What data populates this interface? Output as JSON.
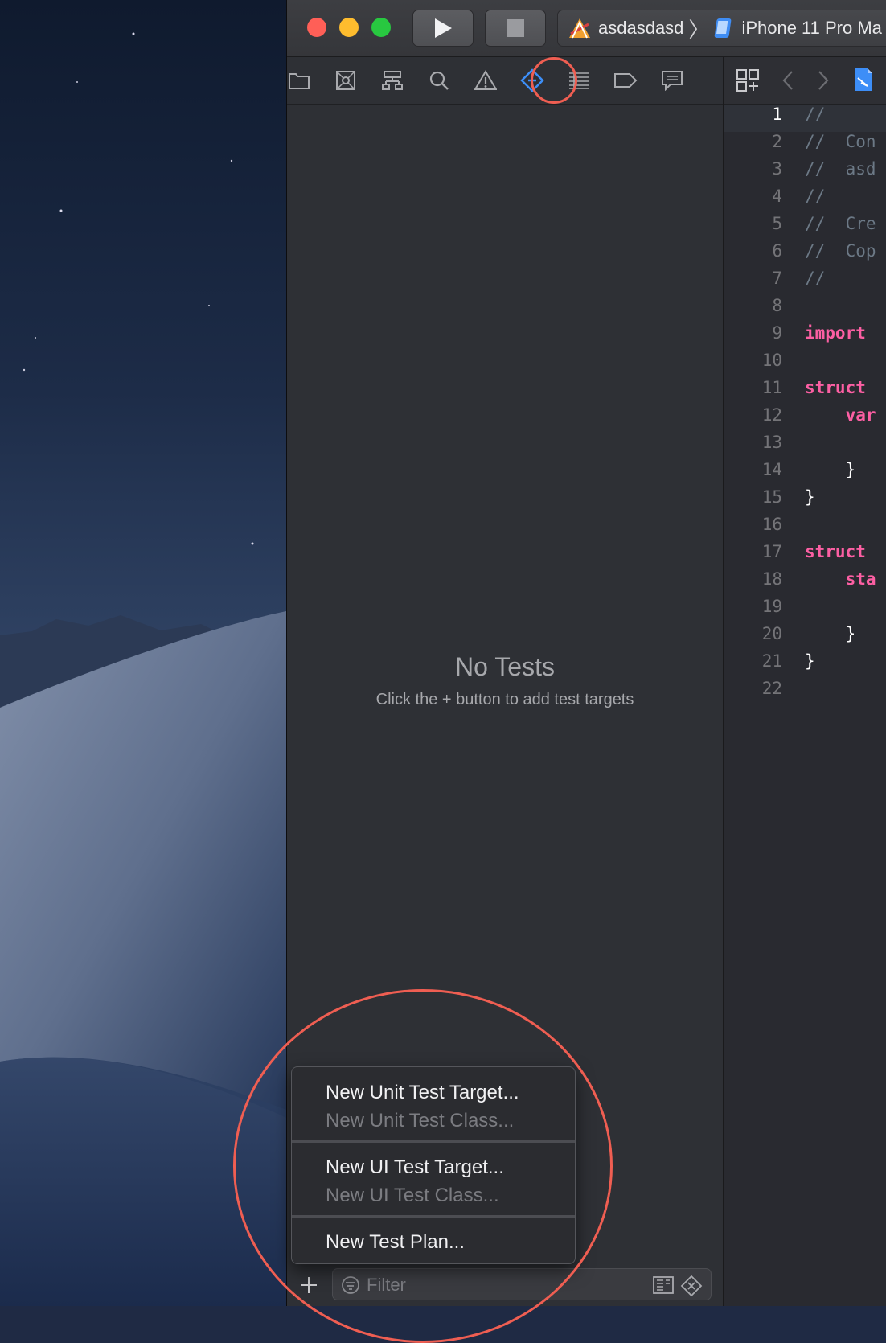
{
  "window": {
    "scheme_project": "asdasdasd",
    "scheme_device": "iPhone 11 Pro Ma"
  },
  "navigator_icons": [
    "folder-icon",
    "source-control-icon",
    "hierarchy-icon",
    "search-icon",
    "warning-icon",
    "test-diamond-icon",
    "debug-icon",
    "breakpoint-icon",
    "report-icon"
  ],
  "test_navigator": {
    "empty_title": "No Tests",
    "empty_subtitle": "Click the + button to add test targets"
  },
  "filter": {
    "placeholder": "Filter"
  },
  "add_menu": {
    "items": [
      {
        "label": "New Unit Test Target...",
        "enabled": true
      },
      {
        "label": "New Unit Test Class...",
        "enabled": false
      },
      {
        "label": "New UI Test Target...",
        "enabled": true
      },
      {
        "label": "New UI Test Class...",
        "enabled": false
      },
      {
        "label": "New Test Plan...",
        "enabled": true
      }
    ]
  },
  "editor": {
    "lines": [
      {
        "n": "1",
        "text": "//"
      },
      {
        "n": "2",
        "text": "//  Con"
      },
      {
        "n": "3",
        "text": "//  asd"
      },
      {
        "n": "4",
        "text": "//"
      },
      {
        "n": "5",
        "text": "//  Cre"
      },
      {
        "n": "6",
        "text": "//  Cop"
      },
      {
        "n": "7",
        "text": "//"
      },
      {
        "n": "8",
        "text": ""
      },
      {
        "n": "9",
        "text": "import"
      },
      {
        "n": "10",
        "text": ""
      },
      {
        "n": "11",
        "text": "struct"
      },
      {
        "n": "12",
        "text": "    var"
      },
      {
        "n": "13",
        "text": ""
      },
      {
        "n": "14",
        "text": "    }"
      },
      {
        "n": "15",
        "text": "}"
      },
      {
        "n": "16",
        "text": ""
      },
      {
        "n": "17",
        "text": "struct"
      },
      {
        "n": "18",
        "text": "    sta"
      },
      {
        "n": "19",
        "text": ""
      },
      {
        "n": "20",
        "text": "    }"
      },
      {
        "n": "21",
        "text": "}"
      },
      {
        "n": "22",
        "text": ""
      }
    ]
  },
  "colors": {
    "accent": "#3d8ef7",
    "annotation": "#ef5e52",
    "keyword": "#fc5fa3"
  }
}
